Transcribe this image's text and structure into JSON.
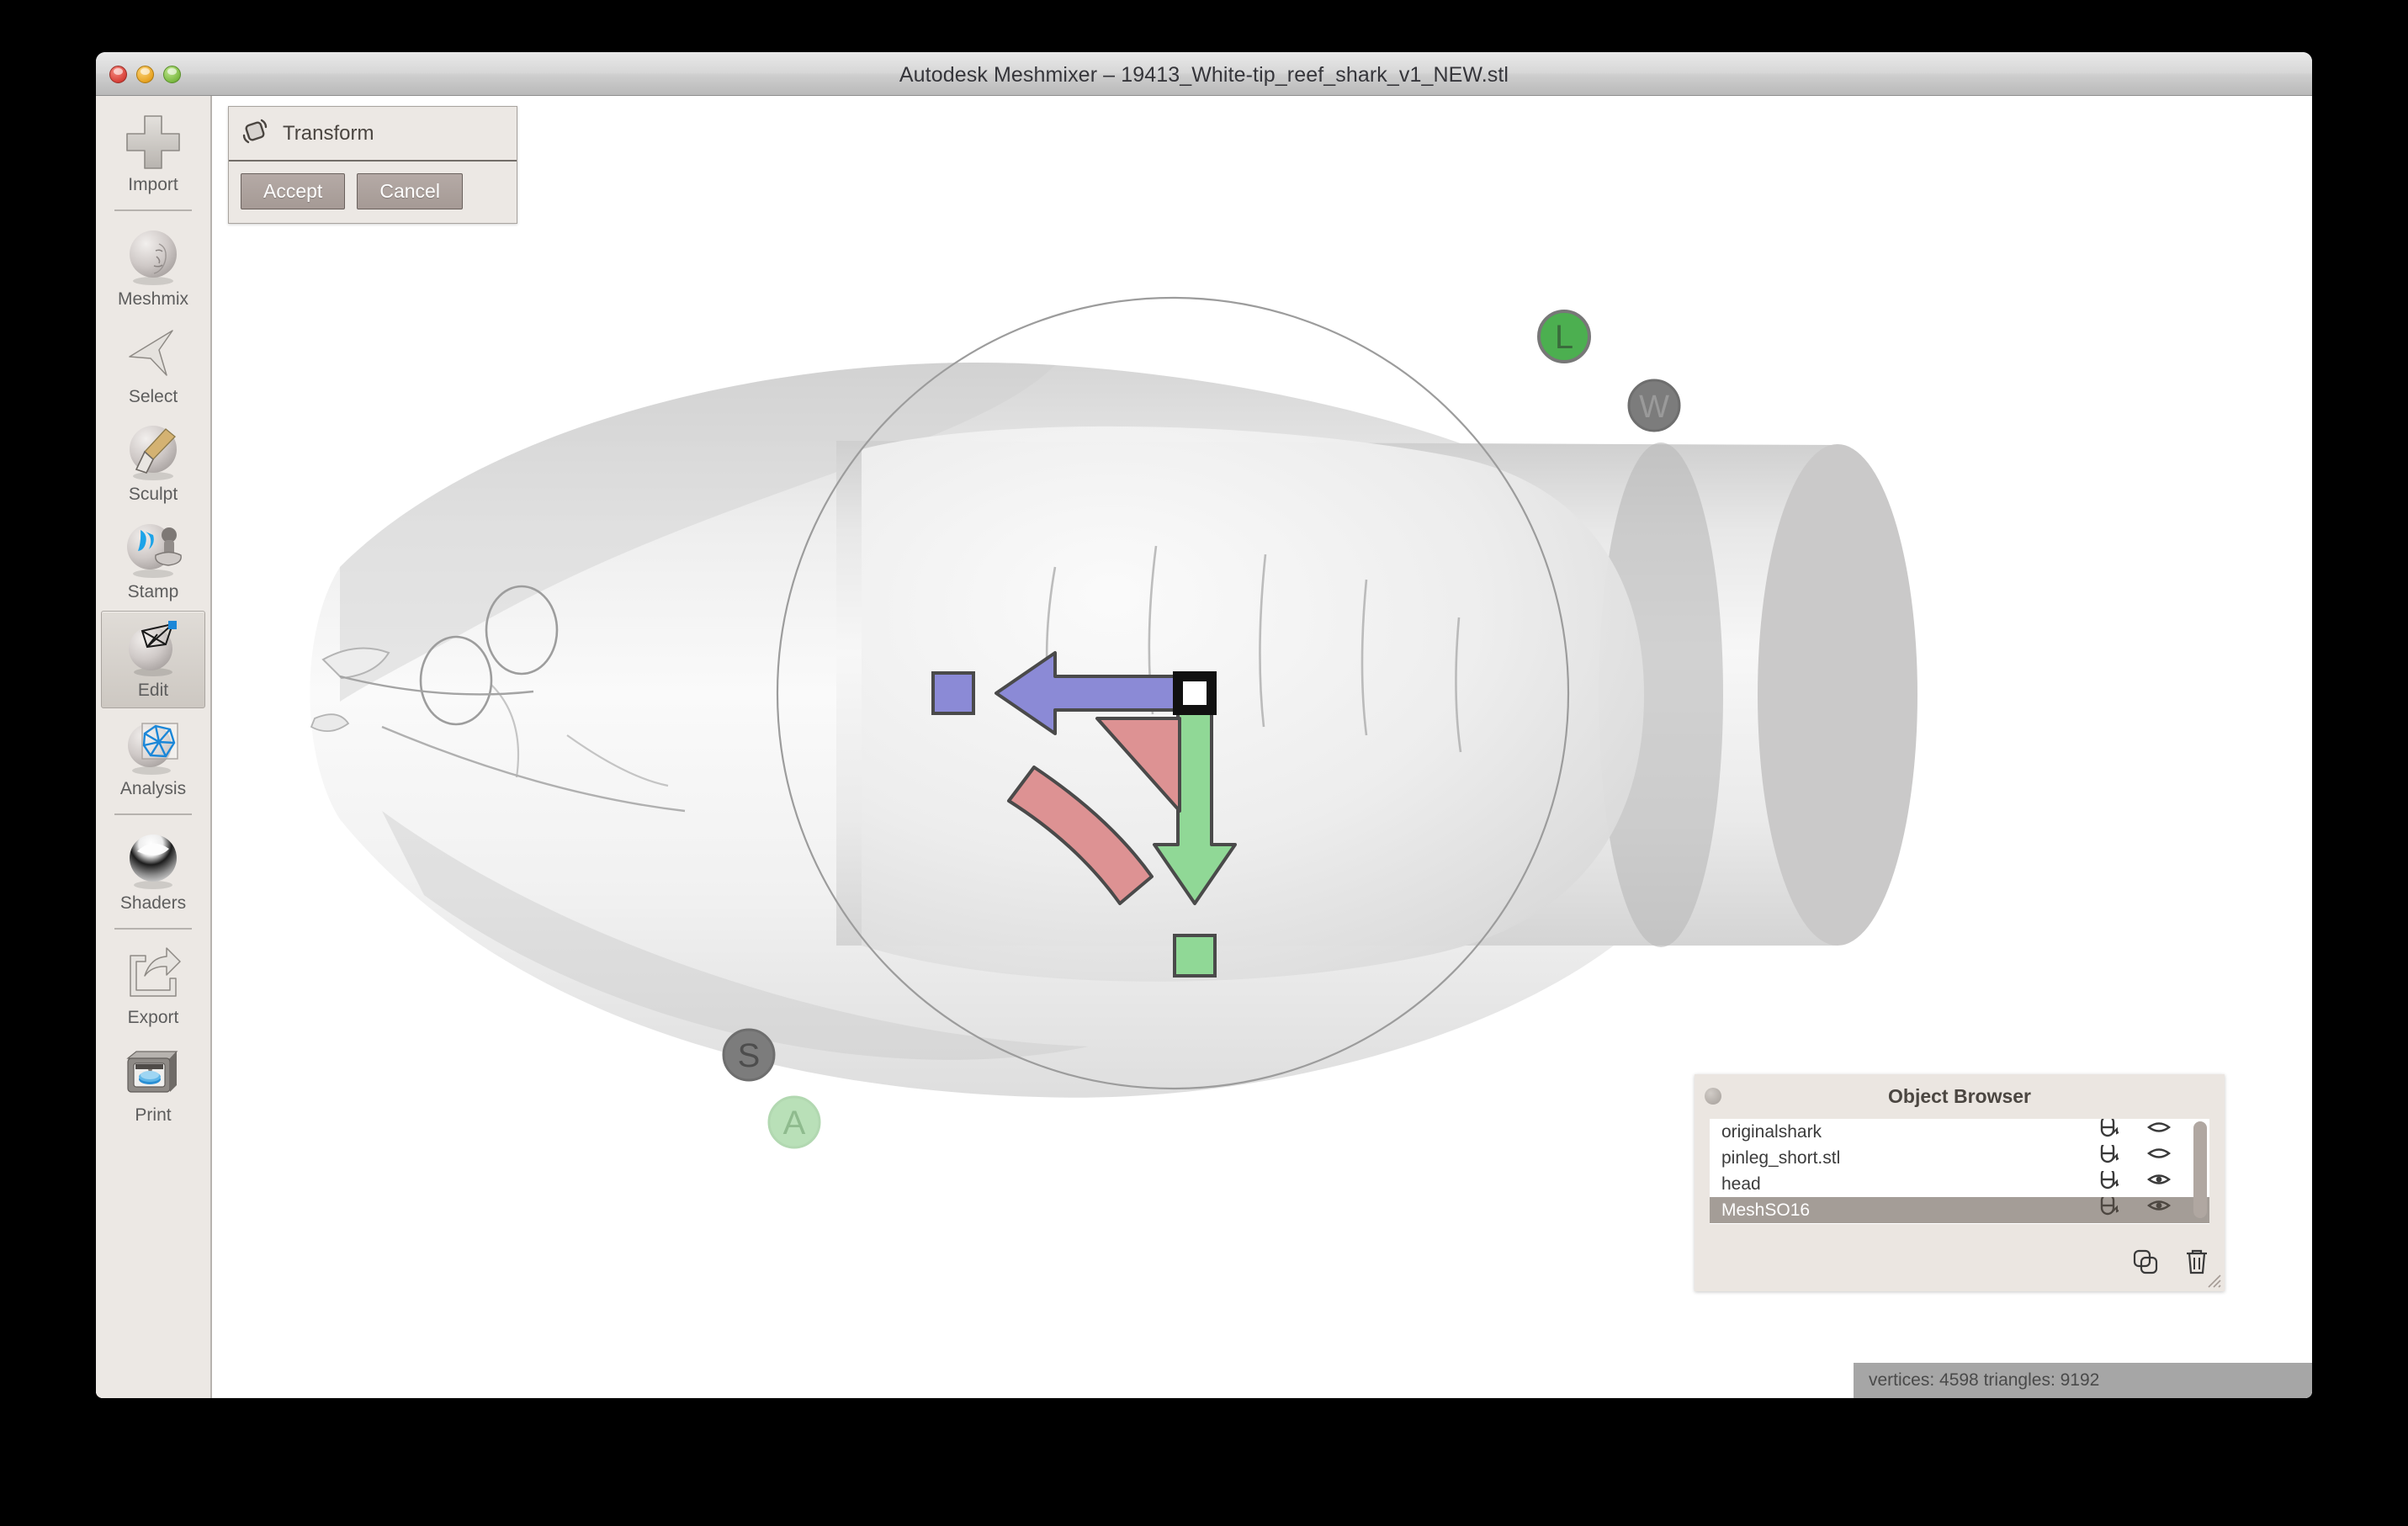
{
  "window": {
    "title": "Autodesk Meshmixer – 19413_White-tip_reef_shark_v1_NEW.stl",
    "controls": {
      "close": "close",
      "minimize": "minimize",
      "maximize": "maximize"
    }
  },
  "tool_rail": {
    "items": [
      {
        "label": "Import",
        "icon": "plus-icon",
        "selected": false
      },
      {
        "label": "Meshmix",
        "icon": "face-sphere-icon",
        "selected": false
      },
      {
        "label": "Select",
        "icon": "cursor-arrow-icon",
        "selected": false
      },
      {
        "label": "Sculpt",
        "icon": "brush-sphere-icon",
        "selected": false
      },
      {
        "label": "Stamp",
        "icon": "stamp-sphere-icon",
        "selected": false
      },
      {
        "label": "Edit",
        "icon": "mesh-sphere-icon",
        "selected": true
      },
      {
        "label": "Analysis",
        "icon": "wireframe-sphere-icon",
        "selected": false
      },
      {
        "label": "Shaders",
        "icon": "shader-sphere-icon",
        "selected": false
      },
      {
        "label": "Export",
        "icon": "export-arrow-icon",
        "selected": false
      },
      {
        "label": "Print",
        "icon": "printer-icon",
        "selected": false
      }
    ]
  },
  "transform_panel": {
    "title": "Transform",
    "icon": "transform-icon",
    "accept_label": "Accept",
    "cancel_label": "Cancel"
  },
  "viewport": {
    "gizmo": {
      "handles": [
        {
          "name": "translate-x-arrow",
          "color": "#8b8ad6",
          "direction": "left"
        },
        {
          "name": "translate-x-handle",
          "color": "#8b8ad6"
        },
        {
          "name": "translate-y-arrow",
          "color": "#90d896",
          "direction": "down"
        },
        {
          "name": "translate-y-handle",
          "color": "#90d896"
        },
        {
          "name": "rotate-arc",
          "color": "#dd9293"
        },
        {
          "name": "scale-wedge",
          "color": "#dd9293"
        },
        {
          "name": "center-handle",
          "color": "#ffffff"
        }
      ],
      "frame_badges": [
        {
          "label": "L",
          "name": "local-frame-badge",
          "color": "#4caf50",
          "active": true
        },
        {
          "label": "W",
          "name": "world-frame-badge",
          "color": "#787878",
          "active": false
        },
        {
          "label": "S",
          "name": "screen-frame-badge",
          "color": "#787878",
          "active": false
        },
        {
          "label": "A",
          "name": "axis-frame-badge",
          "color": "#b9e0b8",
          "active": false
        }
      ]
    }
  },
  "object_browser": {
    "title": "Object Browser",
    "close_icon": "close-icon",
    "items": [
      {
        "name": "originalshark",
        "pin_icon": "magnet-icon",
        "visibility_icon": "eye-closed-icon",
        "visible": false,
        "selected": false
      },
      {
        "name": "pinleg_short.stl",
        "pin_icon": "magnet-icon",
        "visibility_icon": "eye-closed-icon",
        "visible": false,
        "selected": false
      },
      {
        "name": "head",
        "pin_icon": "magnet-icon",
        "visibility_icon": "eye-open-icon",
        "visible": true,
        "selected": false
      },
      {
        "name": "MeshSO16",
        "pin_icon": "magnet-icon",
        "visibility_icon": "eye-open-icon",
        "visible": true,
        "selected": true
      }
    ],
    "footer": [
      {
        "name": "duplicate-button",
        "icon": "duplicate-icon"
      },
      {
        "name": "delete-button",
        "icon": "trash-icon"
      }
    ]
  },
  "status_bar": {
    "text": "vertices: 4598 triangles: 9192"
  },
  "colors": {
    "chrome": "#ece8e4",
    "selection": "#a49d97",
    "accent_green": "#4caf50",
    "axis_x": "#8b8ad6",
    "axis_y": "#90d896",
    "axis_rotate": "#dd9293",
    "status_bg": "#a6a6a6"
  }
}
